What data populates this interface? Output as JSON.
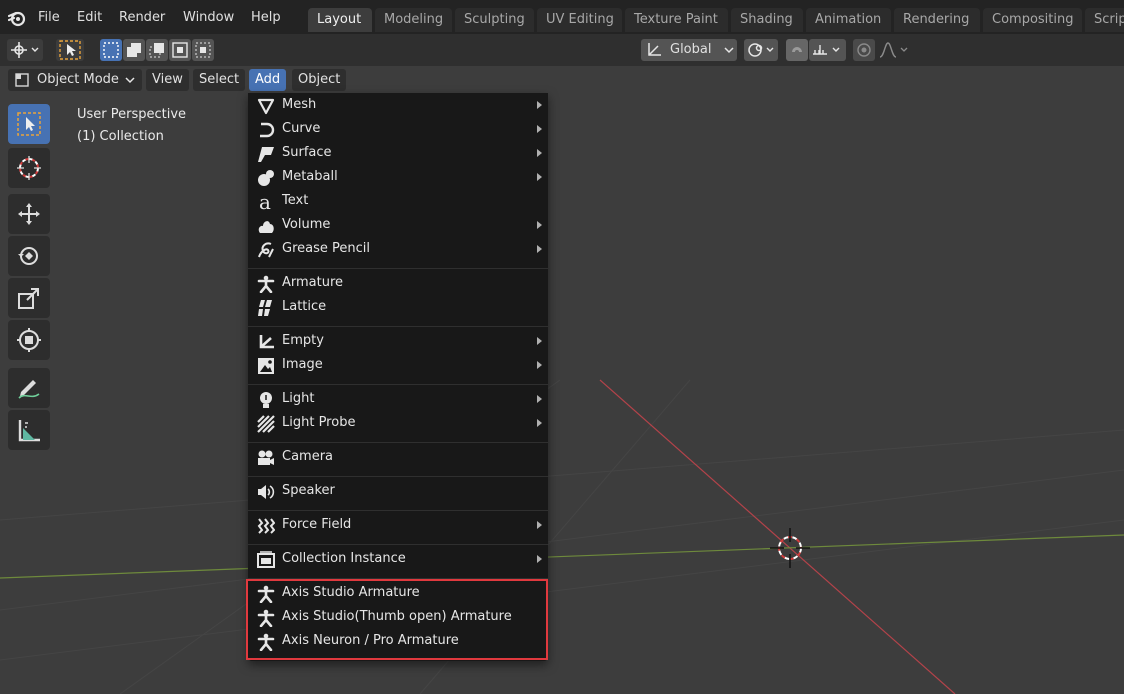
{
  "menubar": {
    "items": [
      "File",
      "Edit",
      "Render",
      "Window",
      "Help"
    ]
  },
  "workspaces": {
    "tabs": [
      "Layout",
      "Modeling",
      "Sculpting",
      "UV Editing",
      "Texture Paint",
      "Shading",
      "Animation",
      "Rendering",
      "Compositing",
      "Scrip"
    ],
    "active": "Layout"
  },
  "toolheader": {
    "orientation": "Global"
  },
  "viewport_header": {
    "mode": "Object Mode",
    "menus": [
      "View",
      "Select",
      "Add",
      "Object"
    ],
    "active_menu": "Add"
  },
  "viewport": {
    "perspective": "User Perspective",
    "collection": "(1) Collection"
  },
  "add_menu": {
    "items": [
      {
        "label": "Mesh",
        "icon": "mesh-icon",
        "submenu": true
      },
      {
        "label": "Curve",
        "icon": "curve-icon",
        "submenu": true
      },
      {
        "label": "Surface",
        "icon": "surface-icon",
        "submenu": true
      },
      {
        "label": "Metaball",
        "icon": "metaball-icon",
        "submenu": true
      },
      {
        "label": "Text",
        "icon": "text-icon",
        "submenu": false
      },
      {
        "label": "Volume",
        "icon": "volume-icon",
        "submenu": true
      },
      {
        "label": "Grease Pencil",
        "icon": "grease-pencil-icon",
        "submenu": true
      },
      {
        "label": "Armature",
        "icon": "armature-icon",
        "submenu": false
      },
      {
        "label": "Lattice",
        "icon": "lattice-icon",
        "submenu": false
      },
      {
        "label": "Empty",
        "icon": "empty-icon",
        "submenu": true
      },
      {
        "label": "Image",
        "icon": "image-icon",
        "submenu": true
      },
      {
        "label": "Light",
        "icon": "light-icon",
        "submenu": true
      },
      {
        "label": "Light Probe",
        "icon": "light-probe-icon",
        "submenu": true
      },
      {
        "label": "Camera",
        "icon": "camera-icon",
        "submenu": false
      },
      {
        "label": "Speaker",
        "icon": "speaker-icon",
        "submenu": false
      },
      {
        "label": "Force Field",
        "icon": "force-field-icon",
        "submenu": true
      },
      {
        "label": "Collection Instance",
        "icon": "collection-instance-icon",
        "submenu": true
      },
      {
        "label": "Axis Studio Armature",
        "icon": "armature-icon",
        "submenu": false
      },
      {
        "label": "Axis Studio(Thumb open) Armature",
        "icon": "armature-icon",
        "submenu": false
      },
      {
        "label": "Axis Neuron / Pro Armature",
        "icon": "armature-icon",
        "submenu": false
      }
    ]
  },
  "colors": {
    "accent": "#4772b3",
    "highlight_box": "#e0393e",
    "x_axis": "#b3434a",
    "y_axis": "#6e8a3c"
  }
}
